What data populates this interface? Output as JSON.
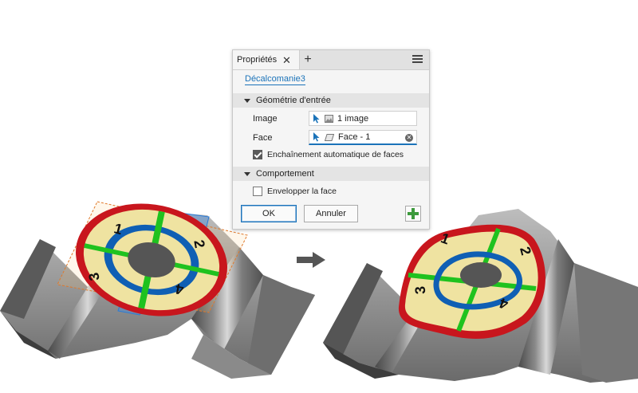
{
  "panel": {
    "tab_label": "Propriétés",
    "tab_close": "✕",
    "tab_add": "+",
    "feature_name": "Décalcomanie3",
    "sections": {
      "input_geometry": "Géométrie d'entrée",
      "behavior": "Comportement"
    },
    "image_row": {
      "label": "Image",
      "value": "1 image"
    },
    "face_row": {
      "label": "Face",
      "value": "Face - 1"
    },
    "chain_faces": {
      "label": "Enchaînement automatique de faces",
      "checked": true
    },
    "wrap_face": {
      "label": "Envelopper la face",
      "checked": false
    },
    "ok_label": "OK",
    "cancel_label": "Annuler"
  },
  "decal": {
    "left_numbers": [
      "1",
      "2",
      "3",
      "4"
    ],
    "right_numbers": [
      "1",
      "2",
      "3",
      "4"
    ]
  },
  "colors": {
    "accent": "#1b73b9",
    "decal_ring": "#c8161d",
    "decal_green": "#1fc21f",
    "decal_blue": "#0f5fb4",
    "decal_fill": "#efe3a1"
  }
}
